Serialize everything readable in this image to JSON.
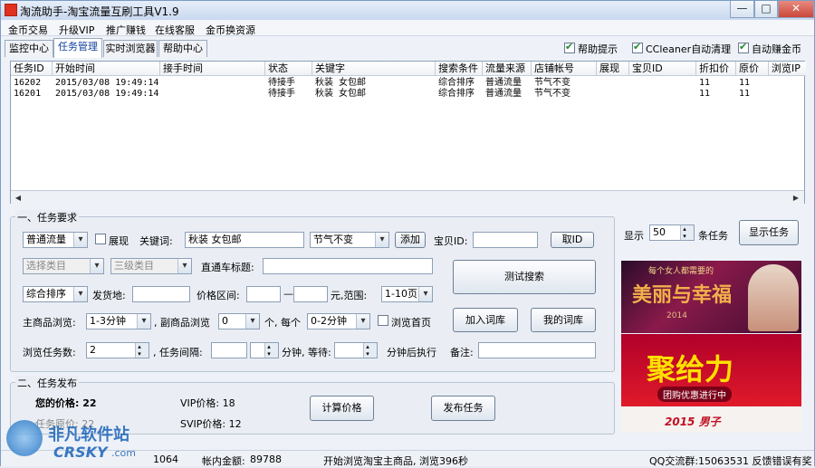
{
  "window": {
    "title": "淘流助手-淘宝流量互刷工具V1.9",
    "btn_min": "—",
    "btn_max": "□",
    "btn_close": "✕"
  },
  "menu": [
    "金币交易",
    "升级VIP",
    "推广赚钱",
    "在线客服",
    "金币换资源"
  ],
  "tabs": [
    "监控中心",
    "任务管理",
    "实时浏览器",
    "帮助中心"
  ],
  "options": {
    "help_tips": "帮助提示",
    "ccleaner": "CCleaner自动清理",
    "auto_coin": "自动赚金币"
  },
  "grid": {
    "headers": [
      "任务ID",
      "开始时间",
      "接手时间",
      "状态",
      "关键字",
      "搜索条件",
      "流量来源",
      "店铺帐号",
      "展现",
      "宝贝ID",
      "折扣价",
      "原价",
      "浏览IP"
    ],
    "rows": [
      [
        "16202",
        "2015/03/08 19:49:14",
        "",
        "待接手",
        "秋装 女包邮",
        "综合排序",
        "普通流量",
        "节气不变",
        "",
        "",
        "11",
        "11",
        ""
      ],
      [
        "16201",
        "2015/03/08 19:49:14",
        "",
        "待接手",
        "秋装 女包邮",
        "综合排序",
        "普通流量",
        "节气不变",
        "",
        "",
        "11",
        "11",
        ""
      ]
    ]
  },
  "requirements": {
    "title": "一、任务要求",
    "traffic_source": "普通流量",
    "exhibit_label": "展现",
    "keyword_label": "关键词:",
    "keyword_value": "秋装 女包邮",
    "shop_value": "节气不变",
    "add_btn": "添加",
    "item_id_label": "宝贝ID:",
    "item_id_value": "",
    "get_id_btn": "取ID",
    "category_l2": "选择类目",
    "category_l3": "三级类目",
    "train_title_label": "直通车标题:",
    "train_title_value": "",
    "sort_value": "综合排序",
    "ship_from_label": "发货地:",
    "price_range_label": "价格区间:",
    "price_dash": "—",
    "price_unit": "元,范围:",
    "page_range": "1-10页",
    "main_browse_label": "主商品浏览:",
    "main_browse_value": "1-3分钟",
    "sub_browse_label": ", 副商品浏览",
    "sub_browse_value": "0",
    "each_label": "个, 每个",
    "each_value": "0-2分钟",
    "browse_home": "浏览首页",
    "task_count_label": "浏览任务数:",
    "task_count_value": "2",
    "interval_label": ", 任务间隔:",
    "minutes_label": "分钟, 等待:",
    "after_label": "分钟后执行",
    "remark_label": "备注:",
    "test_search_btn": "测试搜索",
    "add_lib_btn": "加入词库",
    "my_lib_btn": "我的词库"
  },
  "publish": {
    "title": "二、任务发布",
    "your_price": "您的价格: 22",
    "orig_price": "任务原价: 22",
    "vip_price": "VIP价格: 18",
    "svip_price": "SVIP价格: 12",
    "calc_btn": "计算价格",
    "publish_btn": "发布任务"
  },
  "side": {
    "show_label": "显示",
    "show_value": "50",
    "per_label": "条任务",
    "show_btn": "显示任务"
  },
  "banners": {
    "b1_top": "每个女人都需要的",
    "b1_main": "美丽与幸福",
    "b1_year": "2014",
    "b2_main": "聚给力",
    "b2_sub": "团购优惠进行中",
    "b3_text": "2015 男子"
  },
  "status": {
    "coins": "1064",
    "balance_label": "帐内金额:",
    "balance": "89788",
    "message": "开始浏览淘宝主商品, 浏览396秒",
    "qq": "QQ交流群:15063531 反馈错误有奖"
  },
  "watermark": {
    "cn": "非凡软件站",
    "en": "CRSKY",
    "com": ".com"
  }
}
